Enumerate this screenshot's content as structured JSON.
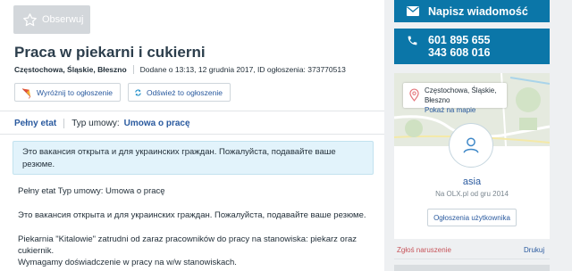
{
  "header": {
    "follow_label": "Obserwuj"
  },
  "ad": {
    "title": "Praca w piekarni i cukierni",
    "location": "Częstochowa, Śląskie, Błeszno",
    "added": "Dodane o 13:13, 12 grudnia 2017, ID ogłoszenia: 373770513",
    "promote_label": "Wyróżnij to ogłoszenie",
    "refresh_label": "Odśwież to ogłoszenie",
    "params": {
      "job_type": "Pełny etat",
      "contract_label": "Typ umowy:",
      "contract_value": "Umowa o pracę"
    },
    "info_box": "Это вакансия открыта и для украинских граждан. Пожалуйста, подавайте ваше резюме.",
    "description": [
      "Pełny etat Typ umowy: Umowa o pracę",
      "Это вакансия открыта и для украинских граждан. Пожалуйста, подавайте ваше резюме.",
      "Piekarnia \"Kitalowie\" zatrudni od zaraz pracowników do pracy na stanowiska: piekarz oraz",
      "cukiernik.",
      "Wymagamy doświadczenie w pracy na w/w stanowiskach."
    ]
  },
  "sidebar": {
    "message_label": "Napisz wiadomość",
    "phones": [
      "601 895 655",
      "343 608 016"
    ],
    "map": {
      "city": "Częstochowa, Śląskie, Błeszno",
      "show_on_map": "Pokaż na mapie"
    },
    "user": {
      "name": "asia",
      "since": "Na OLX.pl od gru 2014",
      "ads_label": "Ogłoszenia użytkownika"
    },
    "report_label": "Zgłoś naruszenie",
    "print_label": "Drukuj"
  },
  "colors": {
    "brand_blue": "#0b76a8",
    "link": "#2a5a9f",
    "info_bg": "#e2f3fb",
    "report_red": "#c7545a"
  }
}
